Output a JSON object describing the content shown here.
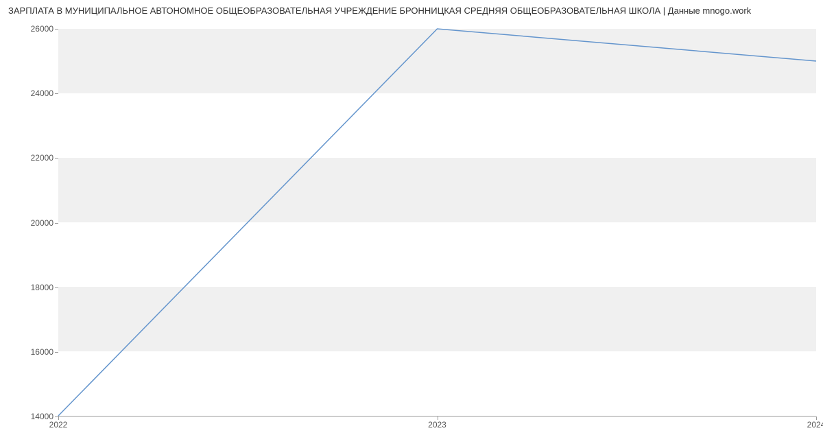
{
  "chart_data": {
    "type": "line",
    "title": "ЗАРПЛАТА В МУНИЦИПАЛЬНОЕ АВТОНОМНОЕ ОБЩЕОБРАЗОВАТЕЛЬНАЯ  УЧРЕЖДЕНИЕ БРОННИЦКАЯ СРЕДНЯЯ ОБЩЕОБРАЗОВАТЕЛЬНАЯ ШКОЛА | Данные mnogo.work",
    "x": [
      2022,
      2023,
      2024
    ],
    "values": [
      14000,
      26000,
      25000
    ],
    "xlabel": "",
    "ylabel": "",
    "y_ticks": [
      14000,
      16000,
      18000,
      20000,
      22000,
      24000,
      26000
    ],
    "x_ticks": [
      2022,
      2023,
      2024
    ],
    "ylim": [
      14000,
      26000
    ],
    "xlim": [
      2022,
      2024
    ],
    "line_color": "#6495cd",
    "band_color": "#f0f0f0"
  }
}
